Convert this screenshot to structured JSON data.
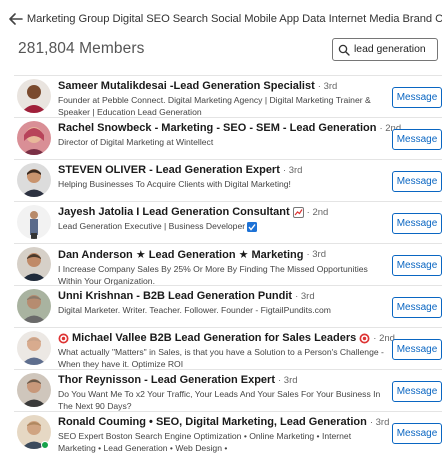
{
  "header": {
    "group_title": "Marketing Group Digital SEO Search Social Mobile App Data Internet Media Brand CRM PR Jobs"
  },
  "members_count": "281,804 Members",
  "search": {
    "value": "lead generation"
  },
  "message_label": "Message",
  "members": [
    {
      "name": "Sameer Mutalikdesai -Lead Generation Specialist",
      "degree": "· 3rd",
      "headline": "Founder at Pebble Connect. Digital Marketing Agency | Digital Marketing Trainer & Speaker | Education Lead Generation",
      "avatar_color": "#7a4a2e"
    },
    {
      "name": "Rachel Snowbeck - Marketing - SEO - SEM - Lead Generation",
      "degree": "· 2nd",
      "headline": "Director of Digital Marketing at Wintellect",
      "avatar_color": "#c77c8c"
    },
    {
      "name": "STEVEN OLIVER - Lead Generation Expert",
      "degree": "· 3rd",
      "headline": "Helping Businesses To Acquire Clients with Digital Marketing!",
      "avatar_color": "#5a4030"
    },
    {
      "name": "Jayesh Jatolia I Lead Generation Consultant",
      "degree": "· 2nd",
      "headline": "Lead Generation Executive | Business Developer",
      "avatar_color": "#9aa4b0"
    },
    {
      "name": "Dan Anderson ★ Lead Generation ★ Marketing",
      "degree": "· 3rd",
      "headline": "I Increase Company Sales By 25% Or More By Finding The Missed Opportunities Within Your Organization.",
      "avatar_color": "#4a3a2c"
    },
    {
      "name": "Unni Krishnan - B2B Lead Generation Pundit",
      "degree": "· 3rd",
      "headline": "Digital Marketer. Writer. Teacher. Follower. Founder - FigtailPundits.com",
      "avatar_color": "#8b7b6b"
    },
    {
      "name": "Michael Vallee B2B Lead Generation for Sales Leaders",
      "degree": "· 2nd",
      "headline": "What actually \"Matters\" in Sales, is that you have a Solution to a Person's Challenge - When they have it. Optimize ROI",
      "avatar_color": "#c9a38a"
    },
    {
      "name": "Thor Reynisson - Lead Generation Expert",
      "degree": "· 3rd",
      "headline": "Do You Want Me To x2 Your Traffic, Your Leads And Your Sales For Your Business In The Next 90 Days?",
      "avatar_color": "#6b5a4a"
    },
    {
      "name": "Ronald Couming • SEO, Digital Marketing, Lead Generation",
      "degree": "· 3rd",
      "headline": "SEO Expert Boston Search Engine Optimization • Online Marketing • Internet Marketing • Lead Generation • Web Design •",
      "avatar_color": "#b08860"
    }
  ]
}
